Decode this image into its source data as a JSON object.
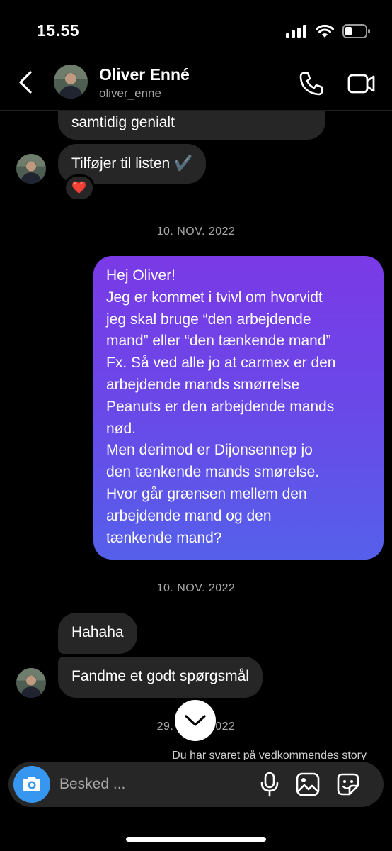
{
  "status_bar": {
    "time": "15.55"
  },
  "header": {
    "name": "Oliver Enné",
    "username": "oliver_enne"
  },
  "messages": {
    "incoming_1": "samtidig genialt",
    "incoming_2": "Tilføjer til listen ✔️",
    "incoming_2_reaction": "❤️",
    "date_1": "10. NOV. 2022",
    "outgoing_lines": [
      "Hej Oliver!",
      "Jeg er kommet i tvivl om hvorvidt",
      "jeg skal bruge “den arbejdende",
      "mand” eller “den tænkende mand”",
      "Fx. Så ved alle jo at carmex er den",
      "arbejdende mands smørrelse",
      "Peanuts er den arbejdende mands",
      "nød.",
      "Men derimod er Dijonsennep jo",
      "den tænkende mands smørelse.",
      "Hvor går grænsen mellem den",
      "arbejdende mand og den",
      "tænkende mand?"
    ],
    "date_2": "10. NOV. 2022",
    "incoming_3": "Hahaha",
    "incoming_4": "Fandme et godt spørgsmål",
    "date_3": "29. NOV. 2022",
    "story_note": "Du har svaret på vedkommendes story"
  },
  "composer": {
    "placeholder": "Besked ..."
  },
  "icons": {
    "back": "chevron-left-icon",
    "call": "phone-icon",
    "video": "video-camera-icon",
    "scroll": "chevron-down-icon",
    "camera": "camera-icon",
    "mic": "microphone-icon",
    "gallery": "image-icon",
    "sticker": "sticker-icon"
  },
  "colors": {
    "background": "#000000",
    "incoming_bubble": "#262626",
    "outgoing_gradient_top": "#7a3ae6",
    "outgoing_gradient_bottom": "#5560ea",
    "camera_button": "#3797f0",
    "secondary_text": "#a8a8a8"
  }
}
